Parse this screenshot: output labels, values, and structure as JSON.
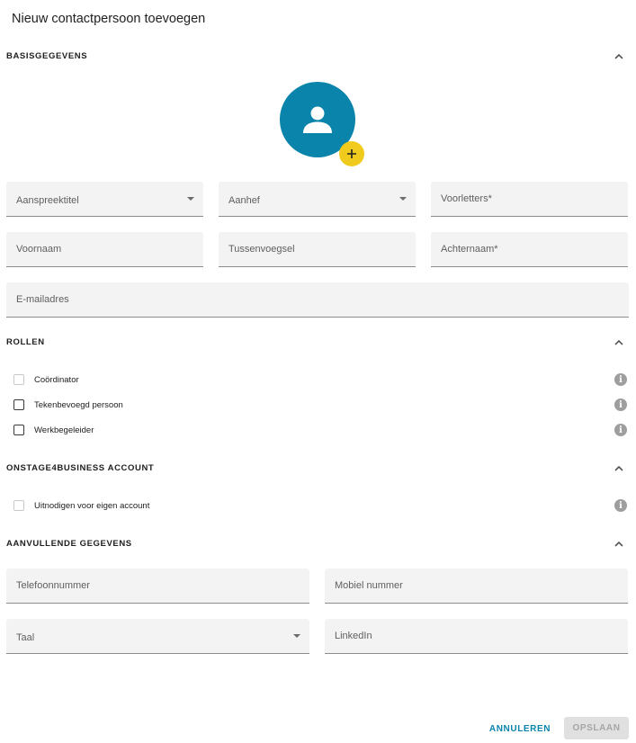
{
  "dialog": {
    "title": "Nieuw contactpersoon toevoegen"
  },
  "sections": {
    "basic": {
      "title": "BASISGEGEVENS"
    },
    "roles": {
      "title": "ROLLEN"
    },
    "account": {
      "title": "ONSTAGE4BUSINESS ACCOUNT"
    },
    "additional": {
      "title": "AANVULLENDE GEGEVENS"
    }
  },
  "fields": {
    "salutation_title": "Aanspreektitel",
    "salutation": "Aanhef",
    "initials": "Voorletters*",
    "first_name": "Voornaam",
    "infix": "Tussenvoegsel",
    "last_name": "Achternaam*",
    "email": "E-mailadres",
    "phone": "Telefoonnummer",
    "mobile": "Mobiel nummer",
    "language": "Taal",
    "linkedin": "LinkedIn"
  },
  "roles": [
    {
      "label": "Coördinator",
      "checked": false
    },
    {
      "label": "Tekenbevoegd persoon",
      "checked": false
    },
    {
      "label": "Werkbegeleider",
      "checked": false
    }
  ],
  "account": {
    "invite_label": "Uitnodigen voor eigen account",
    "checked": false
  },
  "actions": {
    "cancel": "ANNULEREN",
    "save": "OPSLAAN"
  },
  "colors": {
    "accent": "#0a84ab",
    "add_badge": "#f0cb1d",
    "field_bg": "#f3f3f3",
    "info_icon": "#9e9e9e"
  },
  "icons": {
    "avatar": "person-icon",
    "add": "plus-icon",
    "collapse": "chevron-up-icon",
    "info": "info-icon",
    "dropdown": "caret-down-icon"
  }
}
